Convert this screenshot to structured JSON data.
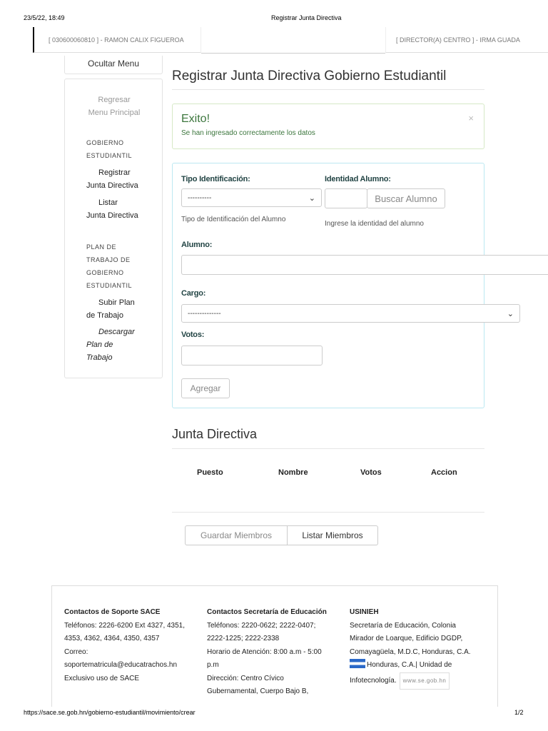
{
  "print_header": {
    "datetime": "23/5/22, 18:49",
    "doc_title": "Registrar Junta Directiva"
  },
  "print_footer": {
    "url": "https://sace.se.gob.hn/gobierno-estudiantil/movimiento/crear",
    "page": "1/2"
  },
  "topbar": {
    "user_left": "[ 030600060810 ] - RAMON CALIX FIGUEROA",
    "user_right": "[ DIRECTOR(A) CENTRO ] - IRMA GUADA"
  },
  "sidebar": {
    "hide_menu": "Ocultar Menu",
    "back": [
      "Regresar",
      "Menu Principal"
    ],
    "section1": [
      "GOBIERNO",
      "ESTUDIANTIL"
    ],
    "link_registrar": [
      "Registrar",
      "Junta Directiva"
    ],
    "link_listar": [
      "Listar",
      "Junta Directiva"
    ],
    "section2": [
      "PLAN DE",
      "TRABAJO DE",
      "GOBIERNO",
      "ESTUDIANTIL"
    ],
    "link_subir": [
      "Subir Plan",
      "de Trabajo"
    ],
    "link_descargar": [
      "Descargar",
      "Plan de",
      "Trabajo"
    ]
  },
  "main": {
    "title": "Registrar Junta Directiva Gobierno Estudiantil",
    "alert": {
      "title": "Exito!",
      "message": "Se han ingresado correctamente los datos",
      "close": "×"
    },
    "form": {
      "tipo_label": "Tipo Identificación:",
      "tipo_value": "----------",
      "tipo_help": "Tipo de Identificación del Alumno",
      "identidad_label": "Identidad Alumno:",
      "identidad_value": "",
      "buscar_button": "Buscar Alumno",
      "identidad_help": "Ingrese la identidad del alumno",
      "alumno_label": "Alumno:",
      "alumno_value": "",
      "cargo_label": "Cargo:",
      "cargo_value": "--------------",
      "votos_label": "Votos:",
      "votos_value": "",
      "agregar_button": "Agregar"
    },
    "junta": {
      "title": "Junta Directiva",
      "columns": [
        "Puesto",
        "Nombre",
        "Votos",
        "Accion"
      ],
      "guardar_button": "Guardar Miembros",
      "listar_button": "Listar Miembros"
    }
  },
  "footer": {
    "soporte": {
      "title": "Contactos de Soporte SACE",
      "lines": [
        "Teléfonos: 2226-6200 Ext 4327, 4351,",
        "4353, 4362, 4364, 4350, 4357",
        "Correo:",
        "soportematricula@educatrachos.hn",
        "Exclusivo uso de SACE"
      ]
    },
    "secretaria": {
      "title": "Contactos Secretaría de Educación",
      "lines": [
        "Teléfonos: 2220-0622; 2222-0407;",
        "2222-1225; 2222-2338",
        "Horario de Atención: 8:00 a.m - 5:00",
        "p.m",
        "Dirección: Centro Cívico",
        "Gubernamental, Cuerpo Bajo B,"
      ]
    },
    "usinieh": {
      "title": "USINIEH",
      "lines": [
        "Secretaría de Educación, Colonia",
        "Mirador de Loarque, Edificio DGDP,",
        "Comayagüela, M.D.C, Honduras, C.A."
      ],
      "flag_line": "Honduras, C.A.| Unidad de",
      "last_line": "Infotecnología.",
      "badge": "www.se.gob.hn"
    }
  }
}
